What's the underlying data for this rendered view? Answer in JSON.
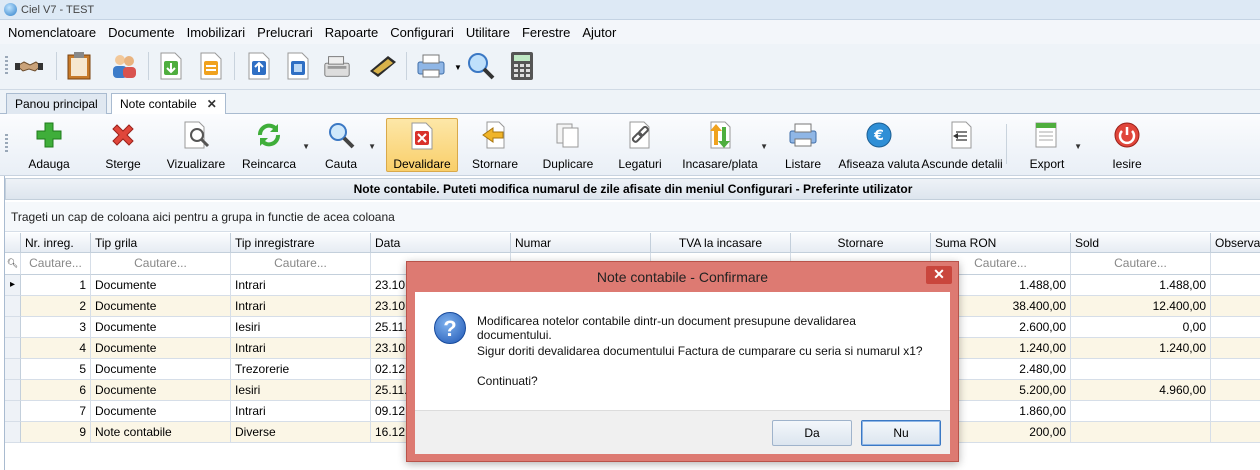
{
  "window": {
    "title": "Ciel V7 - TEST"
  },
  "menu": [
    "Nomenclatoare",
    "Documente",
    "Imobilizari",
    "Prelucrari",
    "Rapoarte",
    "Configurari",
    "Utilitare",
    "Ferestre",
    "Ajutor"
  ],
  "top_toolbar_icons": [
    "handshake-icon",
    "clipboard-icon",
    "users-icon",
    "import-icon",
    "transfer-icon",
    "upload-icon",
    "window-icon",
    "cash-register-icon",
    "wallet-icon",
    "printer-icon",
    "search-globe-icon",
    "calculator-icon"
  ],
  "tabs": [
    {
      "label": "Panou principal",
      "active": false
    },
    {
      "label": "Note contabile",
      "active": true,
      "close": "✕"
    }
  ],
  "toolbar": {
    "adauga": "Adauga",
    "sterge": "Sterge",
    "vizualizare": "Vizualizare",
    "reincarca": "Reincarca",
    "cauta": "Cauta",
    "devalidare": "Devalidare",
    "stornare": "Stornare",
    "duplicare": "Duplicare",
    "legaturi": "Legaturi",
    "incasare": "Incasare/plata",
    "listare": "Listare",
    "afiseaza_valuta": "Afiseaza valuta",
    "ascunde_detalii": "Ascunde detalii",
    "export": "Export",
    "iesire": "Iesire"
  },
  "grid": {
    "caption": "Note contabile. Puteti modifica numarul de zile afisate din meniul Configurari - Preferinte utilizator",
    "group_hint": "Trageti un cap de coloana aici pentru a grupa in functie de acea coloana",
    "columns": [
      "Nr. inreg.",
      "Tip grila",
      "Tip inregistrare",
      "Data",
      "Numar",
      "TVA la incasare",
      "Stornare",
      "Suma RON",
      "Sold",
      "Observat"
    ],
    "filter_placeholder": "Cautare...",
    "rows": [
      {
        "nr": "1",
        "tip_grila": "Documente",
        "tip_inreg": "Intrari",
        "data": "23.10.",
        "suma": "1.488,00",
        "sold": "1.488,00"
      },
      {
        "nr": "2",
        "tip_grila": "Documente",
        "tip_inreg": "Intrari",
        "data": "23.10.",
        "suma": "38.400,00",
        "sold": "12.400,00"
      },
      {
        "nr": "3",
        "tip_grila": "Documente",
        "tip_inreg": "Iesiri",
        "data": "25.11.",
        "suma": "2.600,00",
        "sold": "0,00"
      },
      {
        "nr": "4",
        "tip_grila": "Documente",
        "tip_inreg": "Intrari",
        "data": "23.10.",
        "suma": "1.240,00",
        "sold": "1.240,00"
      },
      {
        "nr": "5",
        "tip_grila": "Documente",
        "tip_inreg": "Trezorerie",
        "data": "02.12.",
        "suma": "2.480,00",
        "sold": ""
      },
      {
        "nr": "6",
        "tip_grila": "Documente",
        "tip_inreg": "Iesiri",
        "data": "25.11.",
        "suma": "5.200,00",
        "sold": "4.960,00"
      },
      {
        "nr": "7",
        "tip_grila": "Documente",
        "tip_inreg": "Intrari",
        "data": "09.12.",
        "suma": "1.860,00",
        "sold": ""
      },
      {
        "nr": "9",
        "tip_grila": "Note contabile",
        "tip_inreg": "Diverse",
        "data": "16.12.",
        "suma": "200,00",
        "sold": ""
      }
    ]
  },
  "dialog": {
    "title": "Note contabile - Confirmare",
    "close": "✕",
    "line1": "Modificarea notelor contabile dintr-un document presupune devalidarea",
    "line2": "documentului.",
    "line3": "Sigur doriti devalidarea documentului Factura de cumparare cu seria si numarul x1?",
    "line4": "Continuati?",
    "yes": "Da",
    "no": "Nu"
  },
  "colors": {
    "dialog_frame": "#dd7a72",
    "active_button": "#f9cf6a",
    "accent": "#1f57b5"
  }
}
